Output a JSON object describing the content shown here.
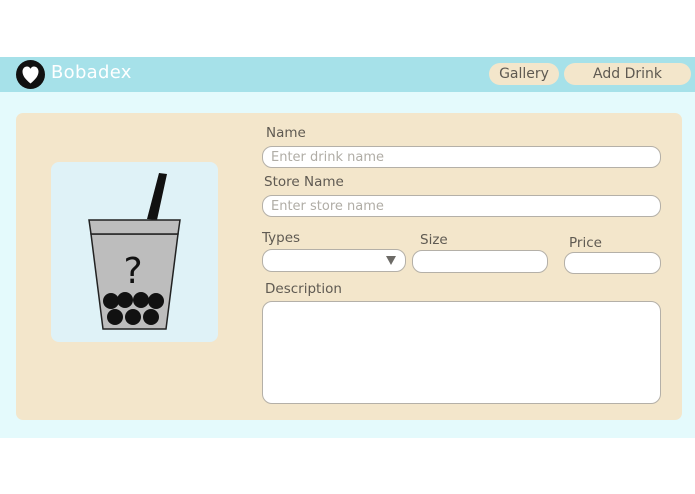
{
  "header": {
    "brand": "Bobadex",
    "nav": [
      {
        "label": "Gallery"
      },
      {
        "label": "Add Drink"
      }
    ]
  },
  "form": {
    "name_label": "Name",
    "name_placeholder": "Enter drink name",
    "store_label": "Store Name",
    "store_placeholder": "Enter store name",
    "types_label": "Types",
    "types_value": "",
    "size_label": "Size",
    "size_value": "",
    "price_label": "Price",
    "price_value": "",
    "description_label": "Description",
    "description_value": ""
  },
  "image": {
    "placeholder_glyph": "?"
  },
  "colors": {
    "header": "#a6e1e9",
    "card": "#f3e6cb",
    "page": "#e4fafc",
    "image_bg": "#dff2f7"
  }
}
